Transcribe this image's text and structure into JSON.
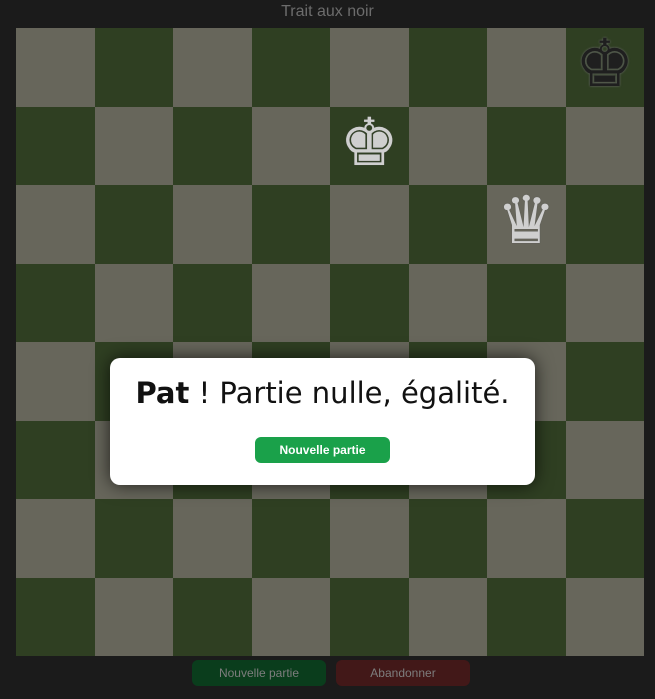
{
  "header": {
    "turn_text": "Trait aux noir"
  },
  "board": {
    "colors": {
      "light": "#67665b",
      "dark": "#2f3f22"
    },
    "pieces": [
      {
        "square": "h8",
        "glyph": "♚",
        "side": "black",
        "icon": "black-king-icon"
      },
      {
        "square": "e7",
        "glyph": "♚",
        "side": "white",
        "icon": "white-king-icon"
      },
      {
        "square": "g6",
        "glyph": "♛",
        "side": "white",
        "icon": "white-queen-icon"
      }
    ]
  },
  "dialog": {
    "title_bold": "Pat",
    "title_rest": " ! Partie nulle, égalité.",
    "button_label": "Nouvelle partie",
    "button_color": "#1aa14a"
  },
  "footer": {
    "new_game_label": "Nouvelle partie",
    "resign_label": "Abandonner"
  }
}
